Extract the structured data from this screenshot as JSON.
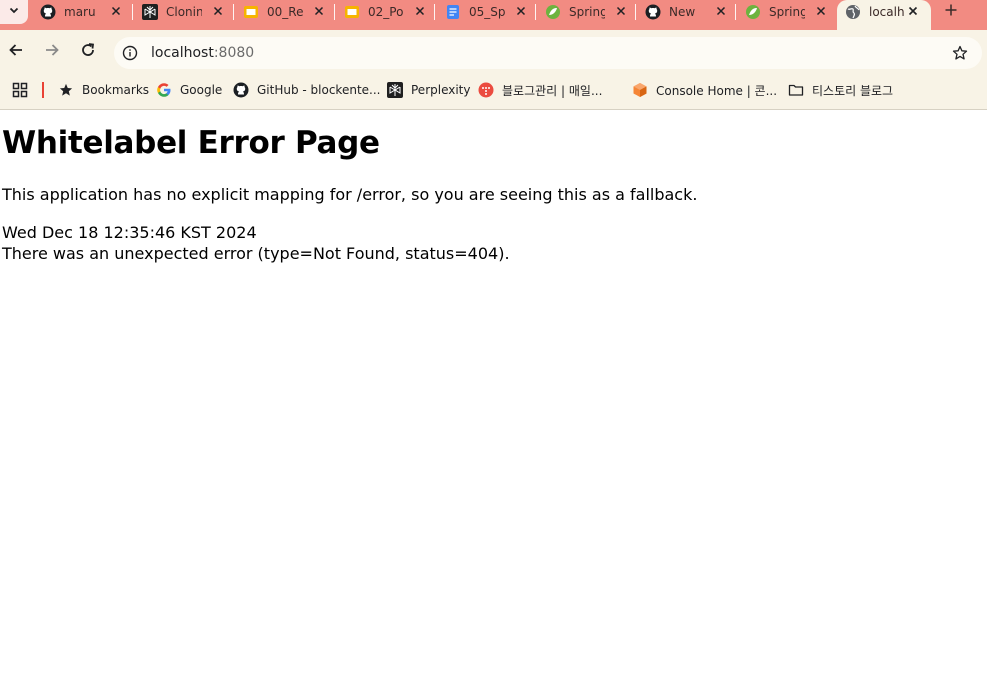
{
  "browser": {
    "tabs": [
      {
        "title": "maru",
        "icon": "github-icon"
      },
      {
        "title": "Clonin",
        "icon": "perplexity-icon"
      },
      {
        "title": "00_Re",
        "icon": "slides-icon"
      },
      {
        "title": "02_Po",
        "icon": "slides-icon"
      },
      {
        "title": "05_Sp",
        "icon": "docs-icon"
      },
      {
        "title": "Spring",
        "icon": "spring-icon"
      },
      {
        "title": "New",
        "icon": "github-icon"
      },
      {
        "title": "Spring",
        "icon": "spring-icon"
      },
      {
        "title": "localh",
        "icon": "globe-icon",
        "active": true
      }
    ],
    "address_bar": {
      "host": "localhost",
      "port": ":8080"
    },
    "bookmarks": [
      {
        "label": "Bookmarks",
        "icon": "star-icon"
      },
      {
        "label": "Google",
        "icon": "google-icon"
      },
      {
        "label": "GitHub - blockente...",
        "icon": "github-icon"
      },
      {
        "label": "Perplexity",
        "icon": "perplexity-icon"
      },
      {
        "label": "블로그관리 | 매일...",
        "icon": "tistory-icon"
      },
      {
        "label": "Console Home | 콘...",
        "icon": "aws-icon"
      },
      {
        "label": "티스토리 블로그",
        "icon": "folder-icon"
      }
    ],
    "colors": {
      "tab_strip": "#f28b82",
      "toolbar": "#f8f3e6"
    }
  },
  "page": {
    "heading": "Whitelabel Error Page",
    "message": "This application has no explicit mapping for /error, so you are seeing this as a fallback.",
    "timestamp": "Wed Dec 18 12:35:46 KST 2024",
    "error": "There was an unexpected error (type=Not Found, status=404)."
  }
}
